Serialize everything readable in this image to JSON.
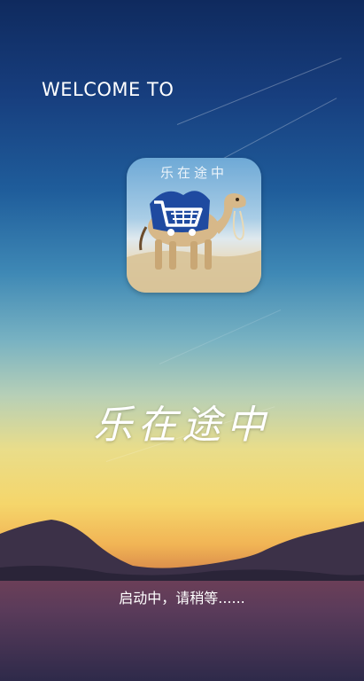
{
  "splash": {
    "welcome_text": "WELCOME TO",
    "app_icon": {
      "caption": "乐在途中",
      "icons": [
        "camel-icon",
        "shopping-cart-icon"
      ]
    },
    "brand_title": "乐在途中",
    "status_text": "启动中，请稍等......"
  }
}
